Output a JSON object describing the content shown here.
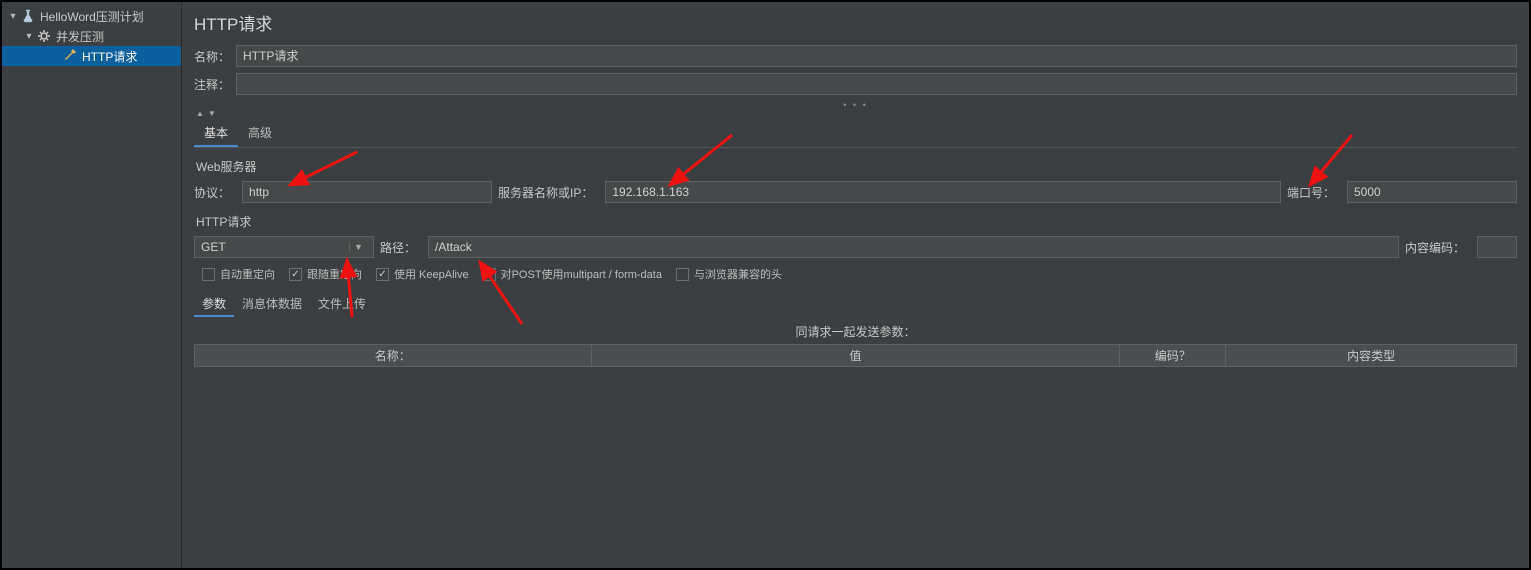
{
  "sidebar": {
    "items": [
      {
        "label": "HelloWord压测计划",
        "icon": "flask"
      },
      {
        "label": "并发压测",
        "icon": "gear"
      },
      {
        "label": "HTTP请求",
        "icon": "dropper"
      }
    ]
  },
  "main": {
    "title": "HTTP请求",
    "name_label": "名称：",
    "name_value": "HTTP请求",
    "comment_label": "注释：",
    "comment_value": "",
    "tabs": {
      "basic": "基本",
      "advanced": "高级"
    },
    "web_server_section": "Web服务器",
    "protocol_label": "协议：",
    "protocol_value": "http",
    "server_label": "服务器名称或IP：",
    "server_value": "192.168.1.163",
    "port_label": "端口号：",
    "port_value": "5000",
    "http_request_section": "HTTP请求",
    "method_value": "GET",
    "path_label": "路径：",
    "path_value": "/Attack",
    "encoding_label": "内容编码：",
    "encoding_value": "",
    "checks": {
      "auto_redirect": "自动重定向",
      "follow_redirect": "跟随重定向",
      "keep_alive": "使用 KeepAlive",
      "multipart": "对POST使用multipart / form-data",
      "browser_compat": "与浏览器兼容的头"
    },
    "sub_tabs": {
      "params": "参数",
      "body": "消息体数据",
      "files": "文件上传"
    },
    "params_title": "同请求一起发送参数：",
    "table_headers": {
      "name": "名称：",
      "value": "值",
      "encode": "编码？",
      "content_type": "内容类型"
    }
  }
}
